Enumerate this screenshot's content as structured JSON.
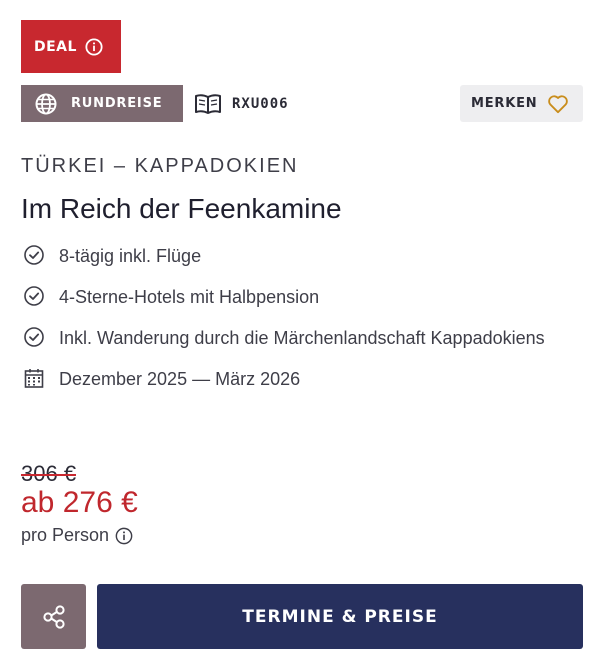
{
  "badges": {
    "deal_label": "DEAL",
    "type_label": "RUNDREISE",
    "code": "RXU006"
  },
  "merken": {
    "label": "MERKEN"
  },
  "trip": {
    "country": "TÜRKEI – KAPPADOKIEN",
    "title": "Im Reich der Feenkamine",
    "features": [
      {
        "icon": "check-circle-icon",
        "text": "8-tägig inkl. Flüge"
      },
      {
        "icon": "check-circle-icon",
        "text": "4-Sterne-Hotels mit Halbpension"
      },
      {
        "icon": "check-circle-icon",
        "text": "Inkl. Wanderung durch die Märchenlandschaft Kappadokiens"
      },
      {
        "icon": "calendar-icon",
        "text": "Dezember 2025 — März 2026"
      }
    ]
  },
  "price": {
    "old": "306 €",
    "new": "ab 276 €",
    "per_person": "pro Person"
  },
  "actions": {
    "cta_label": "TERMINE & PREISE"
  },
  "colors": {
    "deal_red": "#c8282f",
    "badge_mauve": "#7c6970",
    "cta_navy": "#27305e",
    "heart_gold": "#c98d1c",
    "price_red": "#c0272d"
  }
}
